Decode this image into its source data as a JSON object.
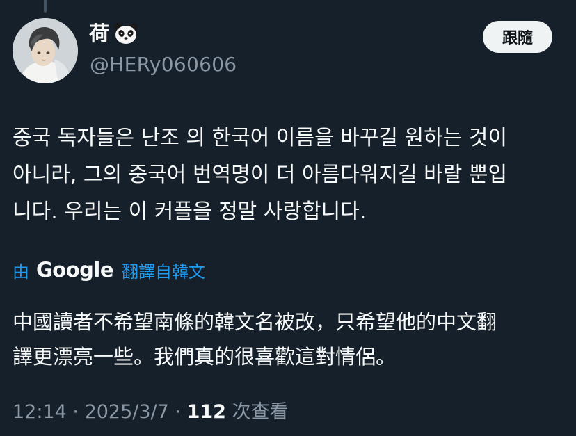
{
  "author": {
    "display_name": "荷",
    "handle": "@HERy060606",
    "emoji_icon": "panda-face-icon"
  },
  "follow_button": {
    "label": "跟隨"
  },
  "tweet": {
    "lines": [
      "중국 독자들은 난조 의 한국어 이름을 바꾸길 원하는 것이",
      "아니라, 그의 중국어 번역명이 더 아름다워지길 바랄 뿐입",
      "니다. 우리는 이 커플을 정말 사랑합니다."
    ]
  },
  "translation": {
    "by_label": "由",
    "provider": "Google",
    "from_label": "翻譯自韓文",
    "lines": [
      "中國讀者不希望南條的韓文名被改，只希望他的中文翻",
      "譯更漂亮一些。我們真的很喜歡這對情侶。"
    ]
  },
  "meta": {
    "time": "12:14",
    "separator1": " · ",
    "date": "2025/3/7",
    "separator2": " · ",
    "views_count": "112",
    "views_label": " 次查看"
  },
  "colors": {
    "background": "#15202b",
    "text_primary": "#f7f9f9",
    "text_secondary": "#8b98a5",
    "link": "#1d9bf0",
    "button_bg": "#eff3f4"
  }
}
